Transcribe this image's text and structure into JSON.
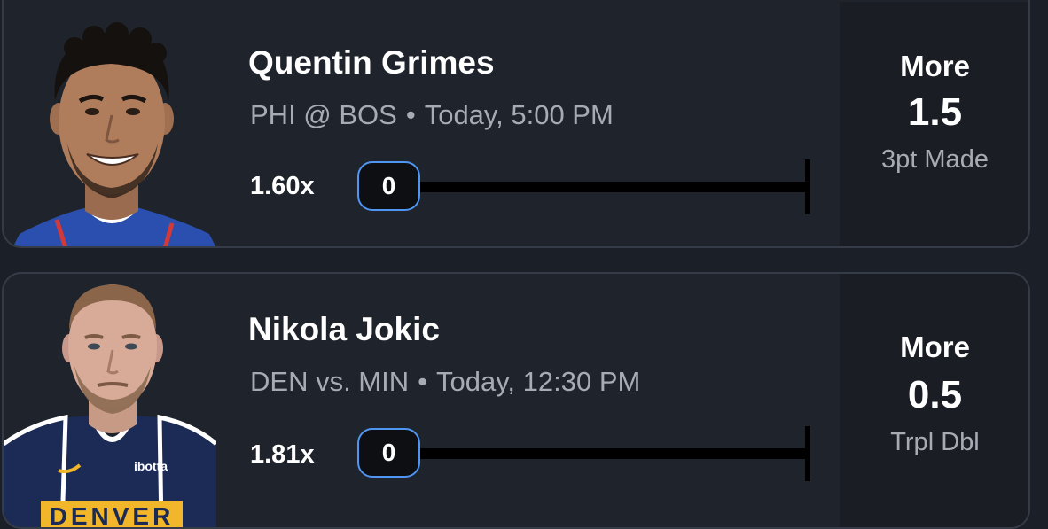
{
  "picks": [
    {
      "player_name": "Quentin Grimes",
      "matchup": "PHI @ BOS",
      "game_time": "Today, 5:00 PM",
      "multiplier": "1.60x",
      "progress_value": "0",
      "direction": "More",
      "line_value": "1.5",
      "stat_type": "3pt Made",
      "jersey_color": "#2b4fae"
    },
    {
      "player_name": "Nikola Jokic",
      "matchup": "DEN vs. MIN",
      "game_time": "Today, 12:30 PM",
      "multiplier": "1.81x",
      "progress_value": "0",
      "direction": "More",
      "line_value": "0.5",
      "stat_type": "Trpl Dbl",
      "jersey_color": "#1c2b55",
      "jersey_sponsor": "ibotta",
      "jersey_wordmark": "DENVER"
    }
  ],
  "separator": "•"
}
